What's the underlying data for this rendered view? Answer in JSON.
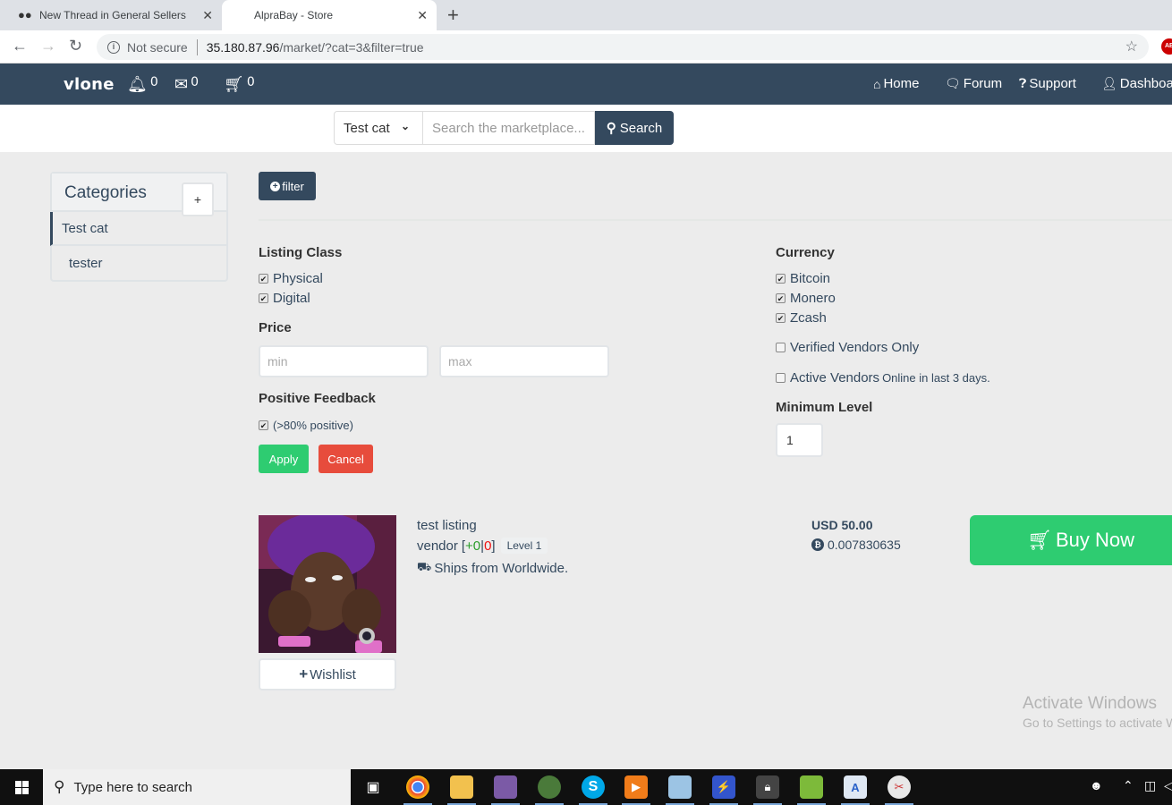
{
  "browser": {
    "tabs": [
      {
        "title": "New Thread in General Sellers Marketplace",
        "icon": "users-icon",
        "active": false
      },
      {
        "title": "AlpraBay - Store",
        "active": true
      }
    ],
    "address": {
      "security_label": "Not secure",
      "url_host": "35.180.87.96",
      "url_path": "/market/?cat=3&filter=true"
    },
    "extension_label": "AB"
  },
  "navbar": {
    "brand": "vlone",
    "counters": [
      {
        "icon": "bell-icon",
        "count": "0"
      },
      {
        "icon": "envelope-icon",
        "count": "0"
      },
      {
        "icon": "cart-icon",
        "count": "0"
      }
    ],
    "links": [
      {
        "icon": "home-icon",
        "label": "Home"
      },
      {
        "icon": "comments-icon",
        "label": "Forum"
      },
      {
        "icon": "question-icon",
        "label": "Support"
      },
      {
        "icon": "user-icon",
        "label": "Dashboard"
      }
    ]
  },
  "search": {
    "category_selected": "Test cat",
    "placeholder": "Search the marketplace...",
    "value": "",
    "button_label": "Search"
  },
  "sidebar": {
    "title": "Categories",
    "add_label": "+",
    "items": [
      {
        "label": "Test cat",
        "active": true
      },
      {
        "label": "tester",
        "active": false
      }
    ]
  },
  "filter": {
    "toggle_label": "filter",
    "listing_class": {
      "heading": "Listing Class",
      "options": [
        {
          "label": "Physical",
          "checked": true
        },
        {
          "label": "Digital",
          "checked": true
        }
      ]
    },
    "price": {
      "heading": "Price",
      "min_placeholder": "min",
      "max_placeholder": "max",
      "min_value": "",
      "max_value": ""
    },
    "positive_feedback": {
      "heading": "Positive Feedback",
      "option_label": "(>80% positive)",
      "checked": true
    },
    "currency": {
      "heading": "Currency",
      "options": [
        {
          "label": "Bitcoin",
          "checked": true
        },
        {
          "label": "Monero",
          "checked": true
        },
        {
          "label": "Zcash",
          "checked": true
        }
      ]
    },
    "verified_vendors": {
      "label": "Verified Vendors Only",
      "checked": false
    },
    "active_vendors": {
      "label": "Active Vendors",
      "note": "Online in last 3 days.",
      "checked": false
    },
    "minimum_level": {
      "heading": "Minimum Level",
      "value": "1"
    },
    "apply_label": "Apply",
    "cancel_label": "Cancel"
  },
  "listing": {
    "title": "test listing",
    "vendor": "vendor",
    "feedback_positive": "+0",
    "feedback_negative": "0",
    "level": "Level 1",
    "ships_from": "Ships from Worldwide.",
    "price_usd": "USD 50.00",
    "price_btc": "0.007830635",
    "wishlist_label": "Wishlist",
    "buy_label": "Buy Now"
  },
  "watermark": {
    "line1": "Activate Windows",
    "line2": "Go to Settings to activate Windows."
  },
  "taskbar": {
    "search_placeholder": "Type here to search",
    "apps": [
      "task-view",
      "chrome",
      "file-explorer",
      "pidgin",
      "tor-browser",
      "skype",
      "media-player",
      "notepad",
      "network-tool",
      "vpn-lock",
      "notepad-plus",
      "wordpad",
      "snipping-tool"
    ]
  },
  "colors": {
    "navbar": "#34495e",
    "success": "#2ecc71",
    "danger": "#e74c3c",
    "page_bg": "#ececec"
  }
}
